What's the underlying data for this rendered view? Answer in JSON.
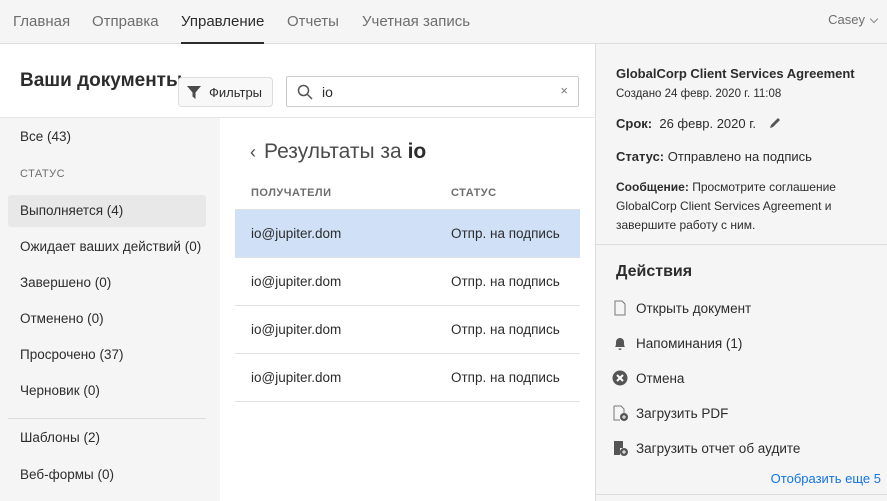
{
  "nav": {
    "tabs": [
      "Главная",
      "Отправка",
      "Управление",
      "Отчеты",
      "Учетная запись"
    ],
    "active": "Управление",
    "user": "Casey"
  },
  "header": {
    "title": "Ваши документы",
    "filters_label": "Фильтры",
    "search_value": "io",
    "clear": "×"
  },
  "sidebar": {
    "all": "Все (43)",
    "status_label": "СТАТУС",
    "items": [
      "Выполняется (4)",
      "Ожидает ваших действий (0)",
      "Завершено (0)",
      "Отменено (0)",
      "Просрочено (37)",
      "Черновик (0)"
    ],
    "templates": "Шаблоны (2)",
    "webforms": "Веб-формы (0)"
  },
  "results": {
    "prefix": "Результаты за ",
    "query": "io",
    "col_recipients": "ПОЛУЧАТЕЛИ",
    "col_status": "СТАТУС",
    "rows": [
      {
        "recipient": "io@jupiter.dom",
        "status": "Отпр. на подпись"
      },
      {
        "recipient": "io@jupiter.dom",
        "status": "Отпр. на подпись"
      },
      {
        "recipient": "io@jupiter.dom",
        "status": "Отпр. на подпись"
      },
      {
        "recipient": "io@jupiter.dom",
        "status": "Отпр. на подпись"
      }
    ]
  },
  "details": {
    "title": "GlobalCorp Client Services Agreement",
    "created": "Создано 24 февр. 2020 г. 11:08",
    "due_label": "Срок:",
    "due": "26 февр. 2020 г.",
    "status_label": "Статус:",
    "status": "Отправлено на подпись",
    "message_label": "Сообщение:",
    "message": "Просмотрите соглашение GlobalCorp Client Services Agreement и завершите работу с ним."
  },
  "actions": {
    "title": "Действия",
    "items": [
      "Открыть документ",
      "Напоминания (1)",
      "Отмена",
      "Загрузить PDF",
      "Загрузить отчет об аудите"
    ],
    "more": "Отобразить еще 5"
  },
  "colors": {
    "selected_row": "#cfe0f7",
    "link": "#1473e6"
  }
}
